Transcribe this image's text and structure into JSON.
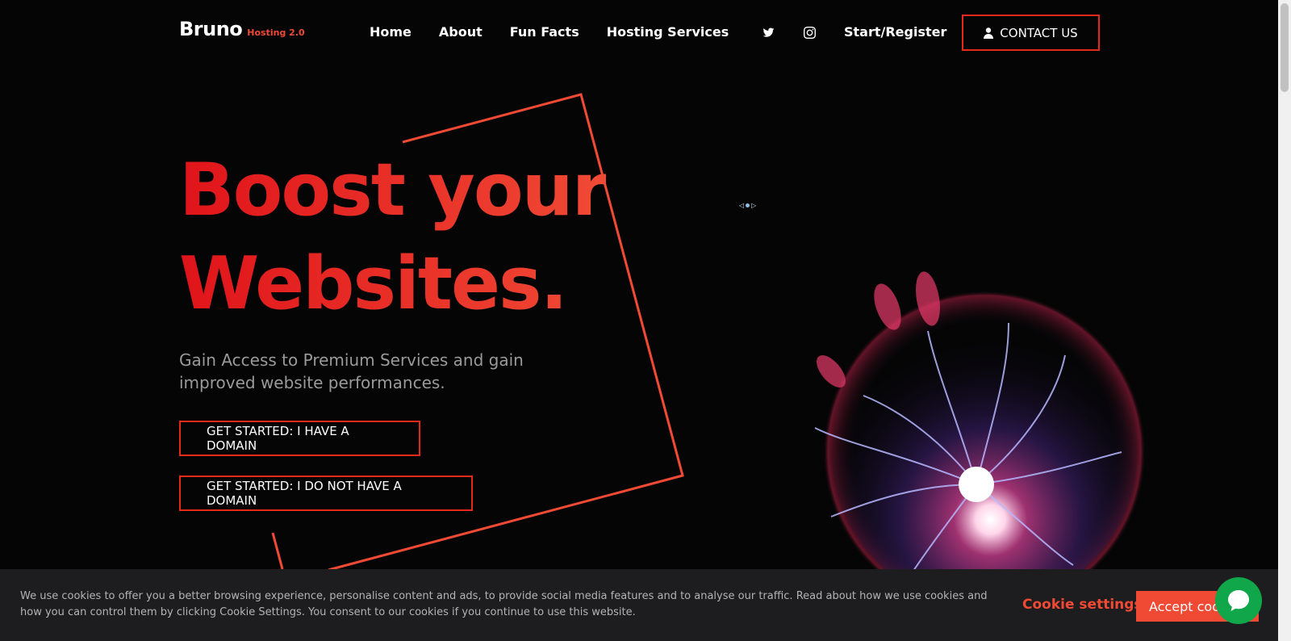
{
  "header": {
    "brand_name": "Bruno",
    "brand_sub": "Hosting 2.0",
    "nav": [
      "Home",
      "About",
      "Fun Facts",
      "Hosting Services"
    ],
    "social_icons": [
      "twitter-icon",
      "instagram-icon"
    ],
    "register_label": "Start/Register",
    "contact_label": "CONTACT US"
  },
  "hero": {
    "headline_line1": "Boost your",
    "headline_line2": "Websites.",
    "subtext": "Gain Access to Premium Services and gain improved website performances.",
    "cta_domain": "GET STARTED: I HAVE A DOMAIN",
    "cta_no_domain": "GET STARTED: I DO NOT HAVE A DOMAIN"
  },
  "cookie": {
    "text": "We use cookies to offer you a better browsing experience, personalise content and ads, to provide social media features and to analyse our traffic. Read about how we use cookies and how you can control them by clicking Cookie Settings. You consent to our cookies if you continue to use this website.",
    "settings_label": "Cookie settings",
    "accept_label": "Accept cookies"
  },
  "colors": {
    "accent": "#f04a35",
    "accent_dark": "#e0141a",
    "background": "#050506",
    "chat": "#10a64a"
  }
}
